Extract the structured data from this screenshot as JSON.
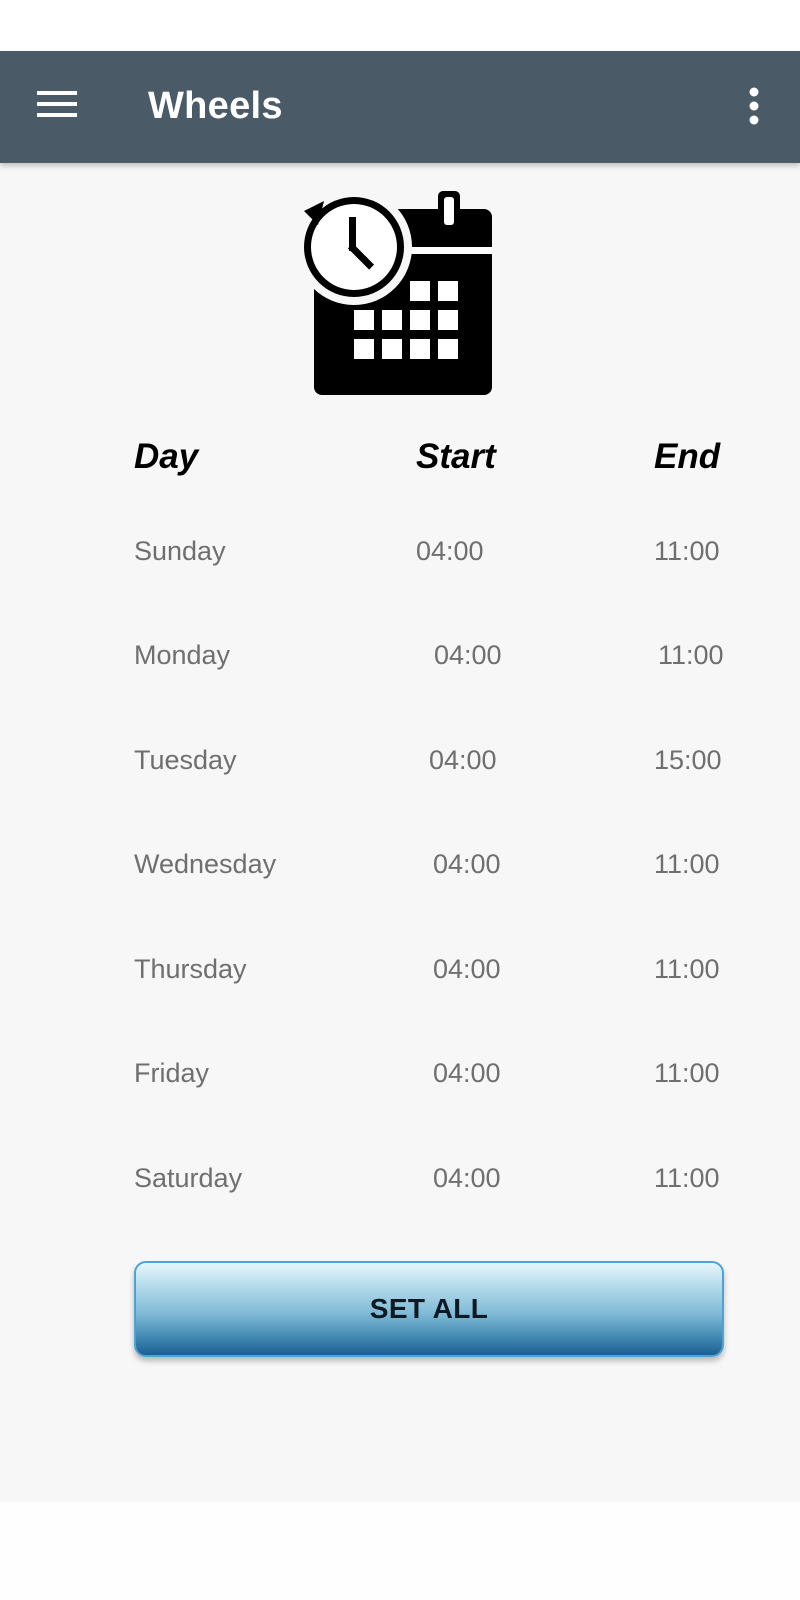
{
  "app_bar": {
    "title": "Wheels",
    "menu_icon": "hamburger-menu-icon",
    "overflow_icon": "more-vert-icon",
    "color": "#4a5b67"
  },
  "schedule": {
    "icon": "calendar-clock-icon",
    "headers": {
      "day": "Day",
      "start": "Start",
      "end": "End"
    },
    "rows": [
      {
        "day": "Sunday",
        "start": "04:00",
        "end": "11:00"
      },
      {
        "day": "Monday",
        "start": "04:00",
        "end": "11:00"
      },
      {
        "day": "Tuesday",
        "start": "04:00",
        "end": "15:00"
      },
      {
        "day": "Wednesday",
        "start": "04:00",
        "end": "11:00"
      },
      {
        "day": "Thursday",
        "start": "04:00",
        "end": "11:00"
      },
      {
        "day": "Friday",
        "start": "04:00",
        "end": "11:00"
      },
      {
        "day": "Saturday",
        "start": "04:00",
        "end": "11:00"
      }
    ]
  },
  "actions": {
    "set_all_label": "SET ALL"
  }
}
